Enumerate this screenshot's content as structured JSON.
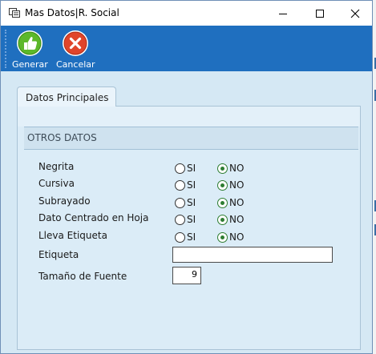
{
  "window": {
    "title": "Mas Datos|R. Social"
  },
  "toolbar": {
    "generate_label": "Generar",
    "cancel_label": "Cancelar"
  },
  "tab": {
    "label": "Datos Principales"
  },
  "section": {
    "title": "OTROS DATOS"
  },
  "options": {
    "yes_label": "SI",
    "no_label": "NO"
  },
  "rows": [
    {
      "label": "Negrita",
      "value": "NO"
    },
    {
      "label": "Cursiva",
      "value": "NO"
    },
    {
      "label": "Subrayado",
      "value": "NO"
    },
    {
      "label": "Dato Centrado en Hoja",
      "value": "NO"
    },
    {
      "label": "Lleva Etiqueta",
      "value": "NO"
    }
  ],
  "etiqueta": {
    "label": "Etiqueta",
    "value": ""
  },
  "font_size": {
    "label": "Tamaño de Fuente",
    "value": "9"
  },
  "colors": {
    "toolbar_bg": "#1f6fbf",
    "content_bg": "#d5e8f4",
    "checked_radio": "#2e7d32"
  }
}
